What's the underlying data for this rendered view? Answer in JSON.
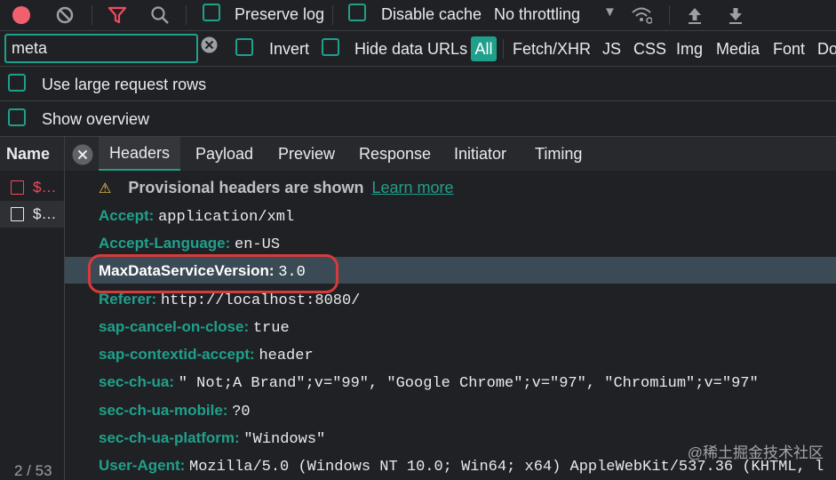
{
  "toolbar": {
    "preserve_log": "Preserve log",
    "disable_cache": "Disable cache",
    "throttling": "No throttling",
    "colors": {
      "record": "#f2606e",
      "filter": "#f04b5f",
      "accent": "#1fa08c"
    }
  },
  "filterbar": {
    "search_value": "meta",
    "invert": "Invert",
    "hide_data_urls": "Hide data URLs",
    "types": [
      "All",
      "Fetch/XHR",
      "JS",
      "CSS",
      "Img",
      "Media",
      "Font",
      "Do"
    ]
  },
  "options": {
    "large_rows": "Use large request rows",
    "show_overview": "Show overview"
  },
  "requests": {
    "column_name": "Name",
    "rows": [
      {
        "label": "$…",
        "status": "error"
      },
      {
        "label": "$…",
        "status": "ok"
      }
    ],
    "footer": "2 / 53"
  },
  "tabs": [
    "Headers",
    "Payload",
    "Preview",
    "Response",
    "Initiator",
    "Timing"
  ],
  "headers": {
    "provisional_text": "Provisional headers are shown",
    "learn_more": "Learn more",
    "items": [
      {
        "name": "Accept:",
        "value": "application/xml"
      },
      {
        "name": "Accept-Language:",
        "value": "en-US"
      },
      {
        "name": "MaxDataServiceVersion:",
        "value": "3.0"
      },
      {
        "name": "Referer:",
        "value": "http://localhost:8080/"
      },
      {
        "name": "sap-cancel-on-close:",
        "value": "true"
      },
      {
        "name": "sap-contextid-accept:",
        "value": "header"
      },
      {
        "name": "sec-ch-ua:",
        "value": "\" Not;A Brand\";v=\"99\", \"Google Chrome\";v=\"97\", \"Chromium\";v=\"97\""
      },
      {
        "name": "sec-ch-ua-mobile:",
        "value": "?0"
      },
      {
        "name": "sec-ch-ua-platform:",
        "value": "\"Windows\""
      },
      {
        "name": "User-Agent:",
        "value": "Mozilla/5.0 (Windows NT 10.0; Win64; x64) AppleWebKit/537.36 (KHTML, l"
      }
    ]
  },
  "watermark": "@稀土掘金技术社区"
}
